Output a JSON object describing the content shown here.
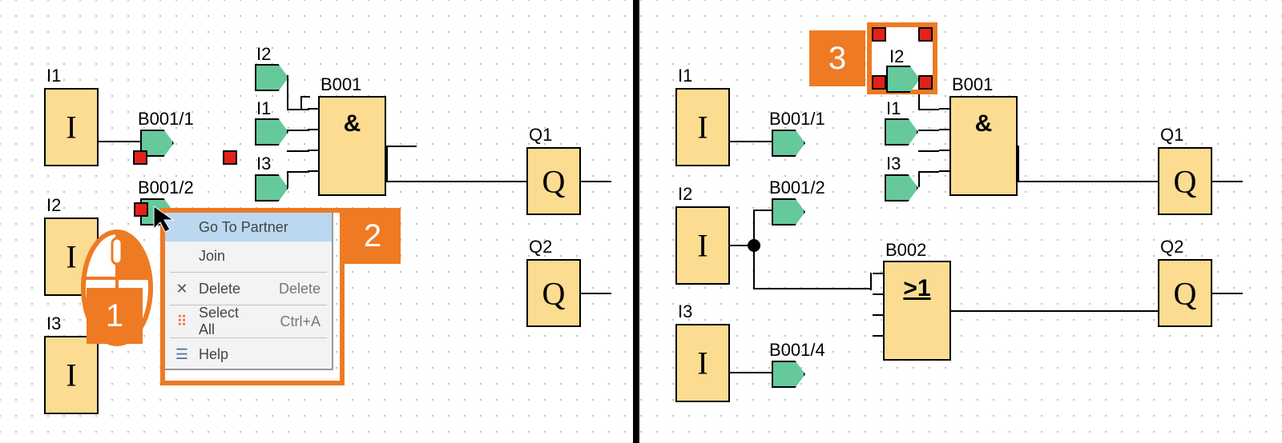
{
  "left": {
    "inputs": [
      {
        "name": "I1",
        "sym": "I"
      },
      {
        "name": "I2",
        "sym": "I"
      },
      {
        "name": "I3",
        "sym": "I"
      }
    ],
    "cuts": [
      "B001/1",
      "B001/2"
    ],
    "gateInputs": [
      "I2",
      "I1",
      "I3"
    ],
    "gate": {
      "name": "B001",
      "sym": "&"
    },
    "outputs": [
      {
        "name": "Q1",
        "sym": "Q"
      },
      {
        "name": "Q2",
        "sym": "Q"
      }
    ]
  },
  "context_menu": {
    "items": [
      {
        "label": "Go To Partner",
        "shortcut": "",
        "icon": ""
      },
      {
        "label": "Join",
        "shortcut": "",
        "icon": ""
      },
      {
        "sep": true
      },
      {
        "label": "Delete",
        "shortcut": "Delete",
        "icon": "x"
      },
      {
        "sep": true
      },
      {
        "label": "Select All",
        "shortcut": "Ctrl+A",
        "icon": "dots"
      },
      {
        "sep": true
      },
      {
        "label": "Help",
        "shortcut": "",
        "icon": "lines"
      }
    ]
  },
  "right": {
    "inputs": [
      {
        "name": "I1",
        "sym": "I"
      },
      {
        "name": "I2",
        "sym": "I"
      },
      {
        "name": "I3",
        "sym": "I"
      }
    ],
    "cuts": [
      "B001/1",
      "B001/2",
      "B001/4"
    ],
    "gateInputs": [
      "I2",
      "I1",
      "I3"
    ],
    "gates": [
      {
        "name": "B001",
        "sym": "&"
      },
      {
        "name": "B002",
        "sym": ">1"
      }
    ],
    "outputs": [
      {
        "name": "Q1",
        "sym": "Q"
      },
      {
        "name": "Q2",
        "sym": "Q"
      }
    ]
  },
  "badges": {
    "b1": "1",
    "b2": "2",
    "b3": "3"
  }
}
